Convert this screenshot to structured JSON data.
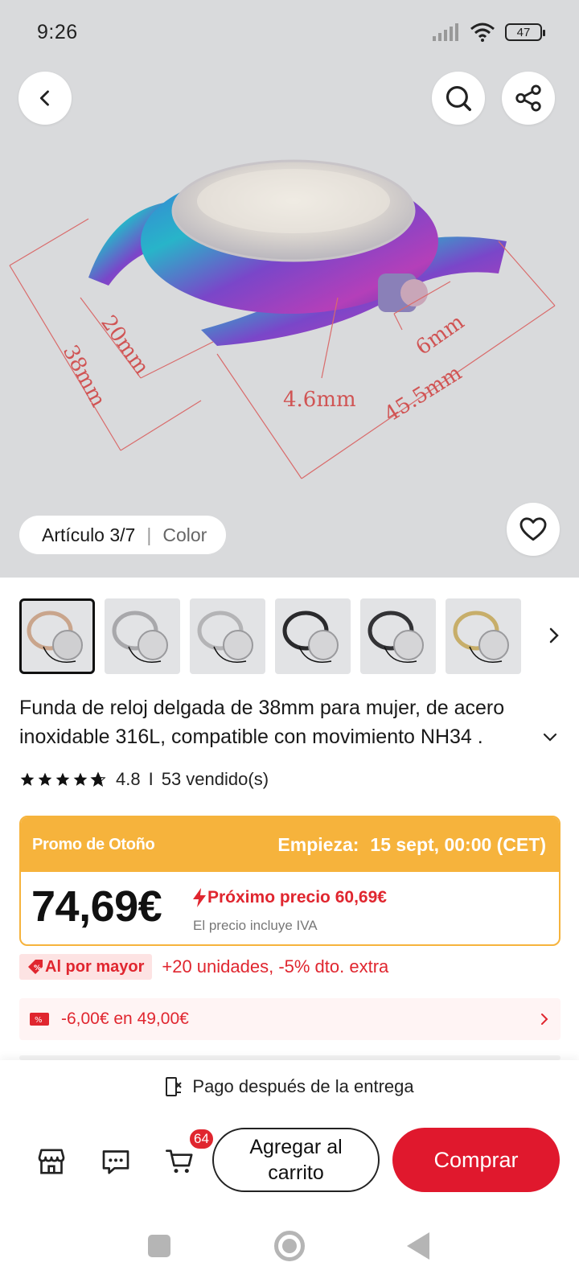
{
  "status_bar": {
    "time": "9:26",
    "battery": "47"
  },
  "hero": {
    "dimension_labels": [
      "20mm",
      "38mm",
      "4.6mm",
      "45.5mm",
      "6mm"
    ],
    "pill_article": "Artículo 3/7",
    "pill_separator": "|",
    "pill_color": "Color",
    "icons": {
      "back": "chevron-left-icon",
      "search": "search-icon",
      "share": "share-icon",
      "wishlist": "heart-icon"
    }
  },
  "thumbnails": [
    {
      "variant": "rose-gold",
      "active": true
    },
    {
      "variant": "silver",
      "active": false
    },
    {
      "variant": "silver",
      "active": false
    },
    {
      "variant": "black",
      "active": false
    },
    {
      "variant": "black",
      "active": false
    },
    {
      "variant": "gold",
      "active": false
    }
  ],
  "product": {
    "title_line1": "Funda de reloj delgada de 38mm para mujer, de acero",
    "title_line2": "inoxidable 316L, compatible con movimiento NH34 .",
    "rating": "4.8",
    "rating_separator": "I",
    "sold": "53 vendido(s)",
    "stars": 4.8
  },
  "promo": {
    "label": "Promo de Otoño",
    "starts_label": "Empieza:",
    "starts_value": "15 sept, 00:00 (CET)",
    "price": "74,69€",
    "next_price": "Próximo precio 60,69€",
    "vat_note": "El precio incluye IVA",
    "colors": {
      "accent": "#f6b33c",
      "red": "#e0262f"
    }
  },
  "wholesale": {
    "tag": "Al por mayor",
    "text": "+20 unidades, -5% dto. extra"
  },
  "coupon": {
    "text": "-6,00€ en 49,00€"
  },
  "bottom_bar": {
    "pay_after": "Pago después de la entrega",
    "cart_badge": "64",
    "add_to_cart": "Agregar al carrito",
    "buy": "Comprar"
  }
}
